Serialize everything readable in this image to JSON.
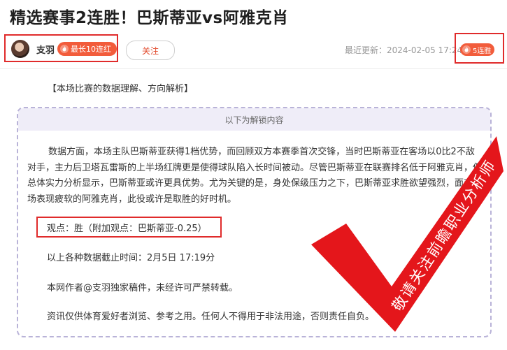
{
  "title": "精选赛事2连胜！巴斯蒂亚vs阿雅克肖",
  "author": {
    "name": "支羽",
    "streak_badge": "最长10连红",
    "follow_label": "关注"
  },
  "updated": "最近更新：2024-02-05 17:24",
  "current_streak": "5连胜",
  "section_heading": "【本场比赛的数据理解、方向解析】",
  "unlock_header": "以下为解锁内容",
  "analysis_paragraph": "数据方面，本场主队巴斯蒂亚获得1档优势，而回顾双方本赛季首次交锋，当时巴斯蒂亚在客场以0比2不敌对手，主力后卫塔瓦雷斯的上半场红牌更是使得球队陷入长时间被动。尽管巴斯蒂亚在联赛排名低于阿雅克肖，但总体实力分析显示，巴斯蒂亚或许更具优势。尤为关键的是，身处保级压力之下，巴斯蒂亚求胜欲望强烈，面对客场表现疲软的阿雅克肖，此役或许是取胜的好时机。",
  "opinion": "观点：胜（附加观点：巴斯蒂亚-0.25）",
  "data_cutoff": "以上各种数据截止时间：2月5日 17:19分",
  "copyright": "本网作者@支羽独家稿件，未经许可严禁转载。",
  "disclaimer": "资讯仅供体育爱好者浏览、参考之用。任何人不得用于非法用途，否则责任自负。",
  "stamp_text": "敬请关注前瞻职业分析师",
  "colors": {
    "accent_red": "#e02b2b",
    "badge_orange": "#f25c3b",
    "unlock_border": "#b9b3d8",
    "unlock_bg": "#efedf8"
  },
  "icons": [
    "avatar",
    "flame-icon",
    "checkmark-stamp"
  ]
}
